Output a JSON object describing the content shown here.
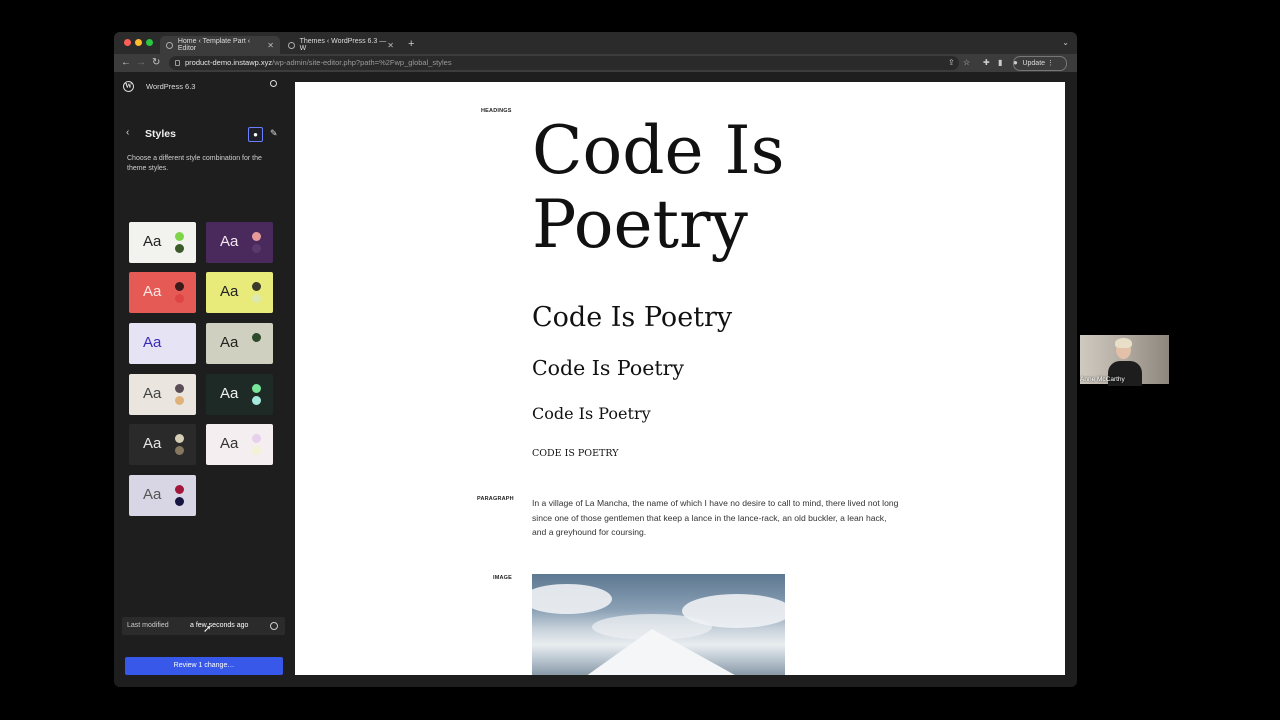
{
  "browser": {
    "tabs": [
      {
        "title": "Home ‹ Template Part ‹ Editor",
        "active": true
      },
      {
        "title": "Themes ‹ WordPress 6.3 — W",
        "active": false
      }
    ],
    "new_tab": "+",
    "url_host": "product-demo.instawp.xyz",
    "url_path": "/wp-admin/site-editor.php?path=%2Fwp_global_styles",
    "update_label": "Update"
  },
  "sidebar": {
    "site_name": "WordPress 6.3",
    "panel_title": "Styles",
    "description": "Choose a different style combination for the theme styles.",
    "variations": [
      {
        "label": "Aa",
        "bg": "#f2f3ee",
        "fg": "#222222",
        "c1": "#7ed54a",
        "c2": "#3d5a2a"
      },
      {
        "label": "Aa",
        "bg": "#4a2a5c",
        "fg": "#f3e6f0",
        "c1": "#e79a9a",
        "c2": "#5a3a6c"
      },
      {
        "label": "Aa",
        "bg": "#e65a55",
        "fg": "#fbe6e3",
        "c1": "#3a1a1a",
        "c2": "#e04545"
      },
      {
        "label": "Aa",
        "bg": "#e8ea7a",
        "fg": "#222222",
        "c1": "#3a3a2a",
        "c2": "#dde9b0"
      },
      {
        "label": "Aa",
        "bg": "#e6e4f4",
        "fg": "#3a2ab8",
        "c1": "#e6e4f4",
        "c2": "#e6e4f4"
      },
      {
        "label": "Aa",
        "bg": "#cfd0bf",
        "fg": "#222222",
        "c1": "#2e4a2a",
        "c2": "#cfd0bf"
      },
      {
        "label": "Aa",
        "bg": "#eae5df",
        "fg": "#444444",
        "c1": "#5a4d55",
        "c2": "#e0b27a"
      },
      {
        "label": "Aa",
        "bg": "#1e2a26",
        "fg": "#f2f2f2",
        "c1": "#78e69a",
        "c2": "#a4e9dc"
      },
      {
        "label": "Aa",
        "bg": "#2a2a2a",
        "fg": "#e6e6e6",
        "c1": "#d5cdb5",
        "c2": "#86785e"
      },
      {
        "label": "Aa",
        "bg": "#f5eef0",
        "fg": "#333333",
        "c1": "#e7d0ec",
        "c2": "#f4f2d6"
      },
      {
        "label": "Aa",
        "bg": "#d8d6e4",
        "fg": "#555555",
        "c1": "#a4163a",
        "c2": "#161640"
      }
    ],
    "last_modified_label": "Last modified",
    "last_modified_value": "a few seconds ago",
    "review_button": "Review 1 change…"
  },
  "canvas": {
    "headings_label": "HEADINGS",
    "big_heading": "Code Is Poetry",
    "h2": "Code Is Poetry",
    "h3": "Code Is Poetry",
    "h4": "Code Is Poetry",
    "h5": "CODE IS POETRY",
    "paragraph_label": "PARAGRAPH",
    "paragraph": "In a village of La Mancha, the name of which I have no desire to call to mind, there lived not long since one of those gentlemen that keep a lance in the lance-rack, an old buckler, a lean hack, and a greyhound for coursing.",
    "image_label": "IMAGE"
  },
  "video": {
    "participant": "Anne McCarthy"
  }
}
